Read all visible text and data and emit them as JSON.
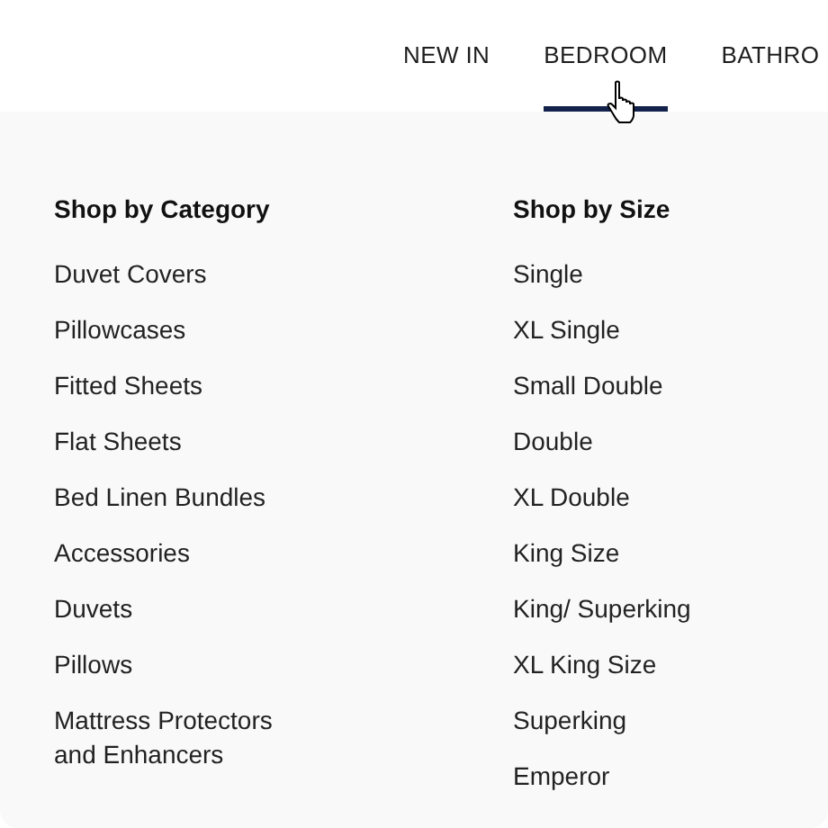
{
  "nav": {
    "tabs": [
      {
        "label": "NEW IN",
        "selected": false
      },
      {
        "label": "BEDROOM",
        "selected": true
      },
      {
        "label": "BATHRO",
        "selected": false
      }
    ]
  },
  "menu": {
    "columns": [
      {
        "heading": "Shop by Category",
        "items": [
          "Duvet Covers",
          "Pillowcases",
          "Fitted Sheets",
          "Flat Sheets",
          "Bed Linen Bundles",
          "Accessories",
          "Duvets",
          "Pillows",
          "Mattress Protectors and Enhancers"
        ]
      },
      {
        "heading": "Shop by Size",
        "items": [
          "Single",
          "XL Single",
          "Small Double",
          "Double",
          "XL Double",
          "King Size",
          "King/ Superking",
          "XL King Size",
          "Superking",
          "Emperor"
        ]
      }
    ]
  }
}
